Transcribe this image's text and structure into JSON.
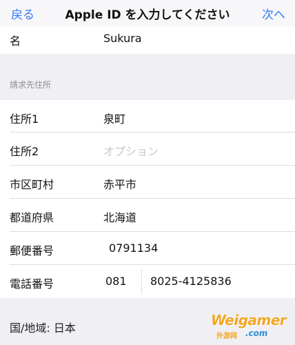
{
  "navbar": {
    "back_label": "戻る",
    "title": "Apple ID を入力してください",
    "next_label": "次へ"
  },
  "name_row": {
    "label": "名",
    "value": "Sukura"
  },
  "billing_section": {
    "header": "請求先住所",
    "rows": [
      {
        "label": "住所1",
        "value": "泉町"
      },
      {
        "label": "住所2",
        "placeholder": "オプション"
      },
      {
        "label": "市区町村",
        "value": "赤平市"
      },
      {
        "label": "都道府県",
        "value": "北海道"
      },
      {
        "label": "郵便番号",
        "value": "0791134"
      }
    ],
    "phone": {
      "label": "電話番号",
      "area_code": "081",
      "number": "8025-4125836"
    }
  },
  "country_region": "国/地域: 日本",
  "watermark": {
    "main": "Weigamer",
    "sub": "外游网",
    "com": ".com"
  }
}
